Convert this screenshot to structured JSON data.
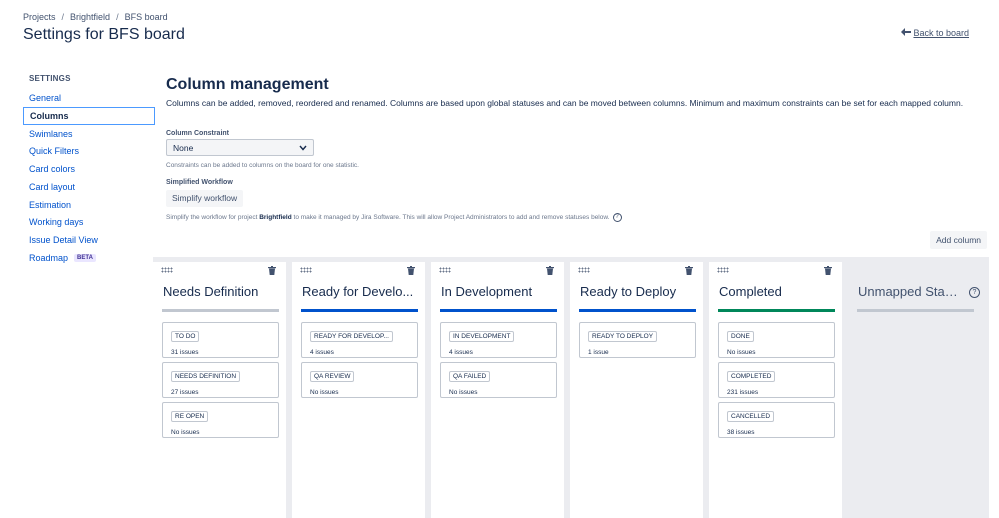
{
  "breadcrumb": {
    "items": [
      "Projects",
      "Brightfield",
      "BFS board"
    ],
    "separator": "/"
  },
  "page_title": "Settings for BFS board",
  "back_link": "Back to board",
  "sidebar": {
    "heading": "SETTINGS",
    "items": [
      {
        "label": "General"
      },
      {
        "label": "Columns",
        "active": true
      },
      {
        "label": "Swimlanes"
      },
      {
        "label": "Quick Filters"
      },
      {
        "label": "Card colors"
      },
      {
        "label": "Card layout"
      },
      {
        "label": "Estimation"
      },
      {
        "label": "Working days"
      },
      {
        "label": "Issue Detail View"
      },
      {
        "label": "Roadmap",
        "badge": "BETA"
      }
    ]
  },
  "main": {
    "title": "Column management",
    "description": "Columns can be added, removed, reordered and renamed. Columns are based upon global statuses and can be moved between columns. Minimum and maximum constraints can be set for each mapped column.",
    "constraint_label": "Column Constraint",
    "constraint_value": "None",
    "constraint_helper": "Constraints can be added to columns on the board for one statistic.",
    "workflow_label": "Simplified Workflow",
    "workflow_button": "Simplify workflow",
    "workflow_helper_pre": "Simplify the workflow for project ",
    "workflow_helper_project": "Brightfield",
    "workflow_helper_post": " to make it managed by Jira Software. This will allow Project Administrators to add and remove statuses below.",
    "add_column": "Add column"
  },
  "colors": {
    "blue_bar": "#0052cc",
    "green_bar": "#00875a",
    "grey_bar": "#c1c7d0"
  },
  "columns": [
    {
      "title": "Needs Definition",
      "bar": "grey",
      "statuses": [
        {
          "name": "TO DO",
          "count": "31 issues"
        },
        {
          "name": "NEEDS DEFINITION",
          "count": "27 issues"
        },
        {
          "name": "RE OPEN",
          "count": "No issues"
        }
      ]
    },
    {
      "title": "Ready for Develo...",
      "bar": "blue",
      "statuses": [
        {
          "name": "READY FOR DEVELOP...",
          "count": "4 issues"
        },
        {
          "name": "QA REVIEW",
          "count": "No issues"
        }
      ]
    },
    {
      "title": "In Development",
      "bar": "blue",
      "statuses": [
        {
          "name": "IN DEVELOPMENT",
          "count": "4 issues"
        },
        {
          "name": "QA FAILED",
          "count": "No issues"
        }
      ]
    },
    {
      "title": "Ready to Deploy",
      "bar": "blue",
      "statuses": [
        {
          "name": "READY TO DEPLOY",
          "count": "1 issue"
        }
      ]
    },
    {
      "title": "Completed",
      "bar": "green",
      "statuses": [
        {
          "name": "DONE",
          "count": "No issues"
        },
        {
          "name": "COMPLETED",
          "count": "231 issues"
        },
        {
          "name": "CANCELLED",
          "count": "38 issues"
        }
      ]
    }
  ],
  "unmapped": {
    "title": "Unmapped Stat..."
  }
}
